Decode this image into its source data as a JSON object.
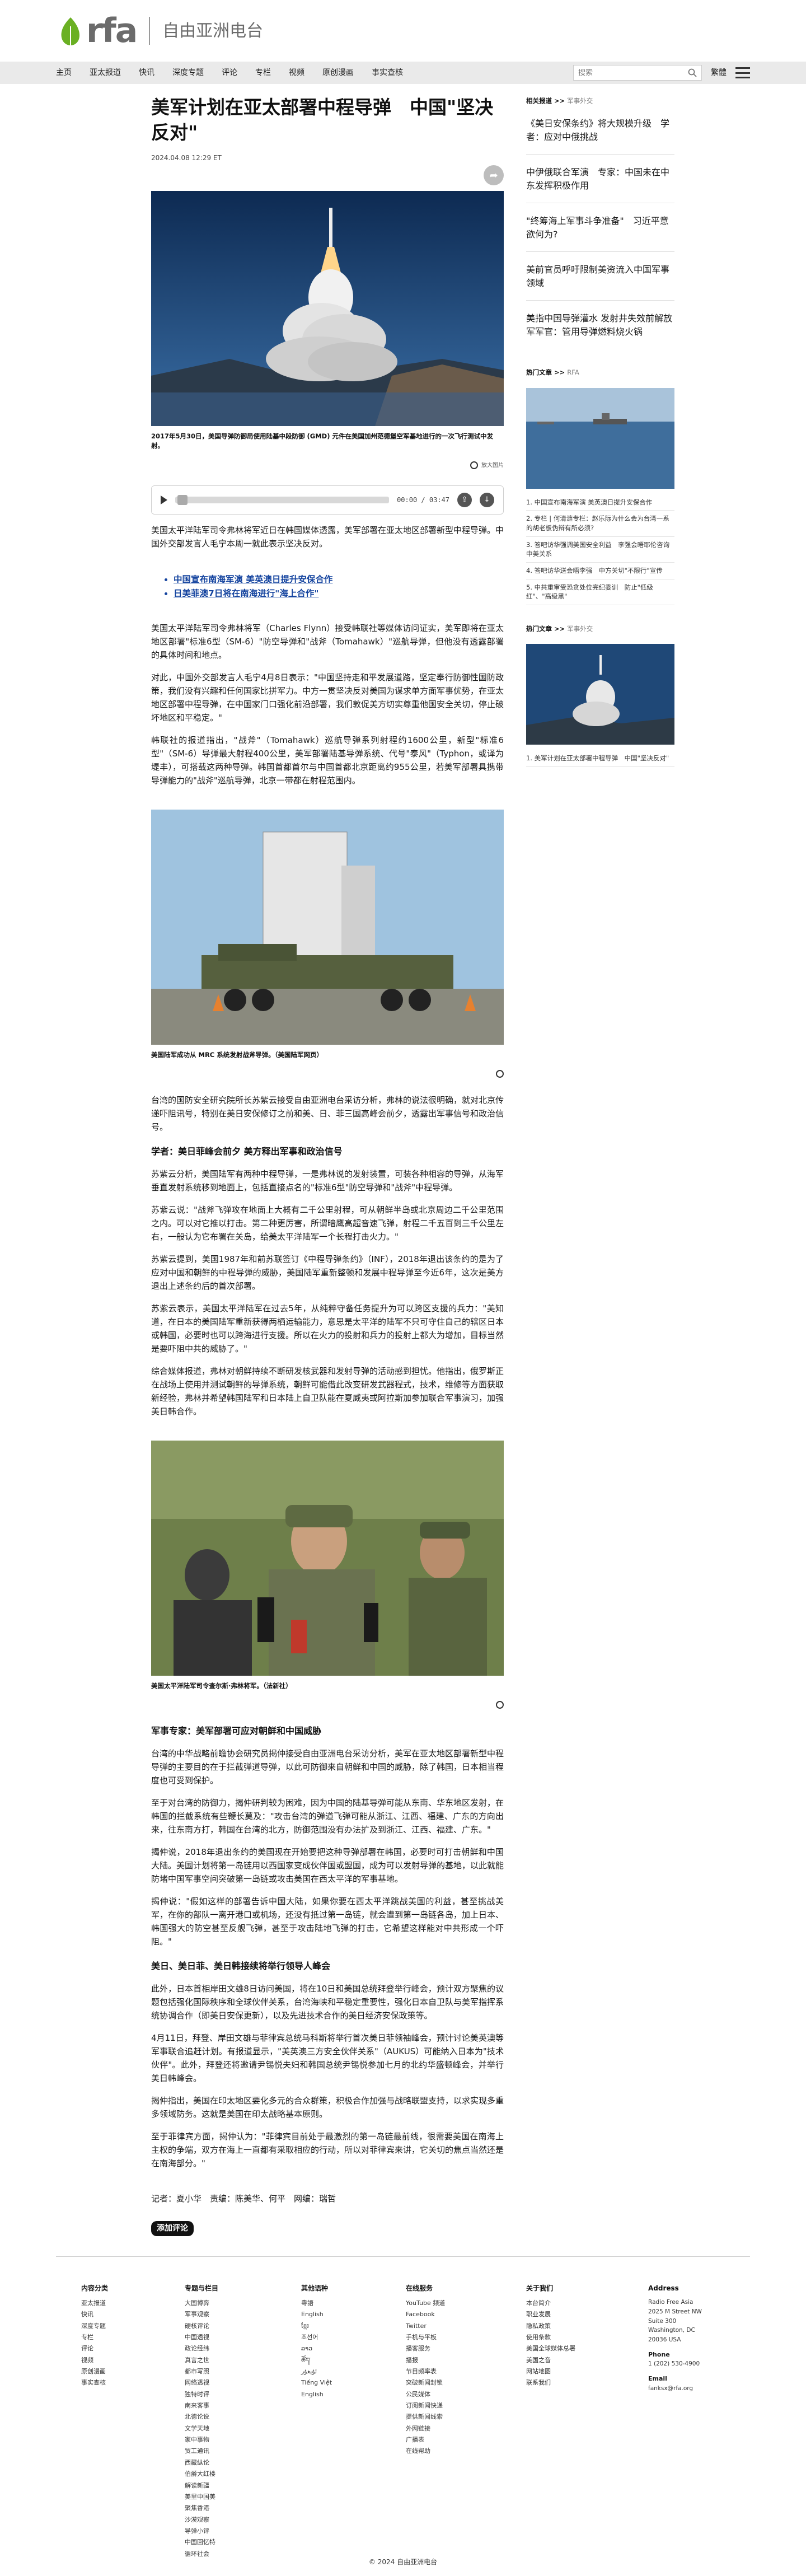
{
  "brand": {
    "logo_text": "rfa",
    "name_cn": "自由亚洲电台",
    "accent": "#6ab023"
  },
  "nav": {
    "items": [
      "主页",
      "亚太报道",
      "快讯",
      "深度专题",
      "评论",
      "专栏",
      "视频",
      "原创漫画",
      "事实查核"
    ],
    "search_placeholder": "搜索",
    "lang": "繁體"
  },
  "article": {
    "title": "美军计划在亚太部署中程导弹　中国\"坚决反对\"",
    "date": "2024.04.08 12:29 ET",
    "photo1_caption": "2017年5月30日，美国导弹防御局使用陆基中段防御 (GMD) 元件在美国加州范德堡空军基地进行的一次飞行测试中发射。",
    "zoom_label": "放大图片",
    "audio": {
      "time": "00:00 / 03:47"
    },
    "intro": "美国太平洋陆军司令弗林将军近日在韩国媒体透露，美军部署在亚太地区部署新型中程导弹。中国外交部发言人毛宁本周一就此表示坚决反对。",
    "related": [
      "中国宣布南海军演 美英澳日提升安保合作",
      "日美菲澳7日将在南海进行\"海上合作\""
    ],
    "para1": "美国太平洋陆军司令弗林将军（Charles Flynn）接受韩联社等媒体访问证实，美军即将在亚太地区部署\"标准6型（SM-6）\"防空导弹和\"战斧（Tomahawk）\"巡航导弹，但他没有透露部署的具体时间和地点。",
    "para2": "对此，中国外交部发言人毛宁4月8日表示：\"中国坚持走和平发展道路，坚定奉行防御性国防政策，我们没有兴趣和任何国家比拼军力。中方一贯坚决反对美国为谋求单方面军事优势，在亚太地区部署中程导弹，在中国家门口强化前沿部署，我们敦促美方切实尊重他国安全关切，停止破坏地区和平稳定。\"",
    "para3": "韩联社的报道指出，\"战斧\"（Tomahawk）巡航导弹系列射程约1600公里，新型\"标准6型\"（SM-6）导弹最大射程400公里，美军部署陆基导弹系统、代号\"泰风\"（Typhon，或译为堤丰），可搭载这两种导弹。韩国首都首尔与中国首都北京距离约955公里，若美军部署具携带导弹能力的\"战斧\"巡航导弹，北京一带都在射程范围内。",
    "photo2_caption": "美国陆军成功从 MRC 系统发射战斧导弹。（美国陆军网页）",
    "para4": "台湾的国防安全研究院所长苏紫云接受自由亚洲电台采访分析，弗林的说法很明确，就对北京传递吓阻讯号，特别在美日安保修订之前和美、日、菲三国高峰会前夕，透露出军事信号和政治信号。",
    "sub1": "学者：美日菲峰会前夕 美方释出军事和政治信号",
    "para5": "苏紫云分析，美国陆军有两种中程导弹，一是弗林说的发射装置，可装各种相容的导弹，从海军垂直发射系统移到地面上，包括直接点名的\"标准6型\"防空导弹和\"战斧\"中程导弹。",
    "para6": "苏紫云说：\"战斧飞弹攻在地面上大概有二千公里射程，可从朝鲜半岛或北京周边二千公里范围之内。可以对它推以打击。第二种更厉害，所谓暗鹰高超音速飞弹，射程二千五百到三千公里左右，一般认为它布署在关岛，给美太平洋陆军一个长程打击火力。\"",
    "para7": "苏紫云提到，美国1987年和前苏联签订《中程导弹条约》（INF），2018年退出该条约的是为了应对中国和朝鲜的中程导弹的威胁，美国陆军重新整顿和发展中程导弹至今近6年，这次是美方退出上述条约后的首次部署。",
    "para8": "苏紫云表示，美国太平洋陆军在过去5年，从纯粹守备任务提升为可以跨区支援的兵力：\"美知道，在日本的美国陆军重新获得两栖运输能力，意思是太平洋的陆军不只可守住自己的辖区日本或韩国，必要时也可以跨海进行支援。所以在火力的投射和兵力的投射上都大为增加，目标当然是要吓阻中共的威胁了。\"",
    "para9": "综合媒体报道，弗林对朝鲜持续不断研发核武器和发射导弹的活动感到担忧。他指出，俄罗斯正在战场上使用并测试朝鲜的导弹系统，朝鲜可能借此改变研发武器程式，技术，维修等方面获取新经验，弗林并希望韩国陆军和日本陆上自卫队能在夏威夷或阿拉斯加参加联合军事演习，加强美日韩合作。",
    "photo3_caption": "美国太平洋陆军司令查尔斯·弗林将军。（法新社）",
    "sub2": "军事专家：美军部署可应对朝鲜和中国威胁",
    "para10": "台湾的中华战略前瞻协会研究员揭仲接受自由亚洲电台采访分析，美军在亚太地区部署新型中程导弹的主要目的在于拦截弹道导弹，以此可防御来自朝鲜和中国的威胁，除了韩国，日本相当程度也可受到保护。",
    "para11": "至于对台湾的防御力，揭仲研判较为困难，因为中国的陆基导弹可能从东南、华东地区发射，在韩国的拦截系统有些鞭长莫及：\"攻击台湾的弹道飞弹可能从浙江、江西、福建、广东的方向出来，往东南方打，韩国在台湾的北方，防御范围没有办法扩及到浙江、江西、福建、广东。\"",
    "para12": "揭仲说，2018年退出条约的美国现在开始要把这种导弹部署在韩国，必要时可打击朝鲜和中国大陆。美国计划将第一岛链用以西国家变成伙伴国或盟国，成为可以发射导弹的基地，以此就能防堵中国军事空间突破第一岛链或攻击美国在西太平洋的军事基地。",
    "para13": "揭仲说：\"假如这样的部署告诉中国大陆，如果你要在西太平洋跳战美国的利益，甚至挑战美军，在你的部队一离开港口或机场，还没有抵过第一岛链，就会遭到第一岛链各岛，加上日本、韩国强大的防空甚至反舰飞弹，甚至于攻击陆地飞弹的打击，它希望这样能对中共形成一个吓阻。\"",
    "sub3": "美日、美日菲、美日韩接续将举行领导人峰会",
    "para14": "此外，日本首相岸田文雄8日访问美国，将在10日和美国总统拜登举行峰会，预计双方聚焦的议题包括强化国际秩序和全球伙伴关系，台湾海峡和平稳定重要性，强化日本自卫队与美军指挥系统协调合作（即美日安保更新），以及先进技术合作的美日经济安保政策等。",
    "para15": "4月11日，拜登、岸田文雄与菲律宾总统马科斯将举行首次美日菲领袖峰会，预计讨论美英澳等军事联合追赶计划。有报道显示，\"美英澳三方安全伙伴关系\"（AUKUS）可能纳入日本为\"技术伙伴\"。此外，拜登还将邀请尹锡悦夫妇和韩国总统尹锡悦参加七月的北约华盛顿峰会，并举行美日韩峰会。",
    "para16": "揭仲指出，美国在印太地区要化多元的合众群策，积极合作加强与战略联盟支持，以求实现多重多领域防务。这就是美国在印太战略基本原则。",
    "para17": "至于菲律宾方面，揭仲认为：\"菲律宾目前处于最激烈的第一岛链最前线，很需要美国在南海上主权的争端，双方在海上一直都有采取相应的行动，所以对菲律宾来讲，它关切的焦点当然还是在南海部分。\"",
    "byline": "记者：夏小华　责编：陈美华、何平　网编：瑞哲",
    "comment_btn": "添加评论"
  },
  "sidebar": {
    "related_head": "相关报道 >>",
    "related_sub": "军事外交",
    "related": [
      "《美日安保条约》将大规模升级　学者：应对中俄挑战",
      "中伊俄联合军演　专家：中国未在中东发挥积极作用",
      "\"终筹海上军事斗争准备\"　习近平意欲何为?",
      "美前官员呼吁限制美资流入中国军事领域",
      "美指中国导弹灌水 发射井失效前解放军军官：管用导弹燃料烧火锅"
    ],
    "hot1_head": "热门文章 >>",
    "hot1_sub": "RFA",
    "hot1_list": [
      "1. 中国宣布南海军演 美英澳日提升安保合作",
      "2. 专栏 | 何清涟专栏：赵乐际为什么会为台湾一系的胡老板伪辩有所必须?",
      "3. 答吧访华强调美国安全利益　李强会晤耶伦咨询中美关系",
      "4. 答吧访华送会晤李强　中方关切\"不限行\"宣传",
      "5. 中共重审受恐贪处位完纪委训　防止\"低级红\"、\"高级黑\""
    ],
    "hot2_head": "热门文章 >>",
    "hot2_sub": "军事外交",
    "hot2_list": [
      "1. 美军计划在亚太部署中程导弹　中国\"坚决反对\""
    ]
  },
  "footer": {
    "col1_title": "内容分类",
    "col1": [
      "亚太报道",
      "快讯",
      "深度专题",
      "专栏",
      "评论",
      "视频",
      "原创漫画",
      "事实查核"
    ],
    "col2_title": "专题与栏目",
    "col2": [
      "大国博弈",
      "军事观察",
      "硬核评论",
      "中国透视",
      "政论经纬",
      "真言之世",
      "都市写照",
      "网络透视",
      "独特时评",
      "南来客事",
      "北德论说",
      "文学天地",
      "家中事物",
      "贸工通讯",
      "西藏纵论",
      "伯爵大红楼",
      "解读新疆",
      "美里中国美",
      "聚焦香港",
      "沙漠观察",
      "导弹小评",
      "中国回忆特",
      "循环社会"
    ],
    "col3_title": "其他语种",
    "col3": [
      "粵語",
      "English",
      "ខ្មែរ",
      "조선어",
      "ລາວ",
      "ཚོད།",
      "ئۇيغۇر",
      "Tiếng Việt",
      "English"
    ],
    "col4_title": "在线服务",
    "col4": [
      "YouTube 频道",
      "Facebook",
      "Twitter",
      "手机与平板",
      "播客服务",
      "播报",
      "节目频率表",
      "突破新闻封锁",
      "公民媒体",
      "订阅新闻快递",
      "提供新闻线索",
      "外网链接",
      "广播表",
      "在线帮助"
    ],
    "col5_title": "关于我们",
    "col5": [
      "本台简介",
      "职业发展",
      "隐私政策",
      "使用条款",
      "美国全球媒体总署",
      "美国之音",
      "网站地图",
      "联系我们"
    ],
    "addr_title": "Address",
    "addr": [
      "Radio Free Asia",
      "2025 M Street NW",
      "Suite 300",
      "Washington, DC",
      "20036 USA"
    ],
    "phone_title": "Phone",
    "phone": "1 (202) 530-4900",
    "email_title": "Email",
    "email": "fanksx@rfa.org",
    "copyright": "© 2024 自由亚洲电台"
  }
}
